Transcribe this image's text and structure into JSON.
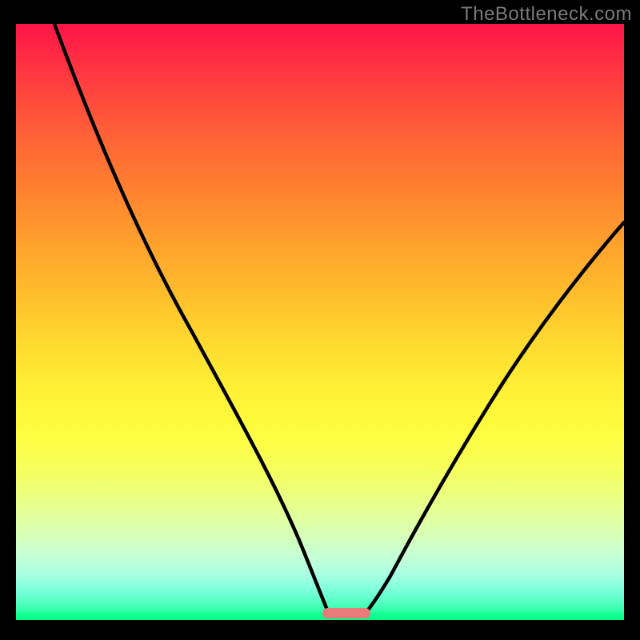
{
  "watermark": "TheBottleneck.com",
  "chart_data": {
    "type": "line",
    "title": "",
    "xlabel": "",
    "ylabel": "",
    "xlim": [
      0,
      100
    ],
    "ylim": [
      0,
      100
    ],
    "grid": false,
    "legend": false,
    "background_gradient": {
      "orientation": "vertical",
      "stops": [
        {
          "pos": 0,
          "color": "#ff1548"
        },
        {
          "pos": 50,
          "color": "#ffcc2e"
        },
        {
          "pos": 75,
          "color": "#f7ff58"
        },
        {
          "pos": 100,
          "color": "#00ff85"
        }
      ]
    },
    "series": [
      {
        "name": "left-curve",
        "x": [
          6,
          13,
          20,
          27,
          34,
          41,
          47,
          52
        ],
        "y": [
          100,
          78,
          58,
          42,
          28,
          16,
          7,
          1
        ]
      },
      {
        "name": "right-curve",
        "x": [
          57,
          62,
          68,
          75,
          82,
          90,
          100
        ],
        "y": [
          1,
          8,
          18,
          30,
          44,
          58,
          67
        ]
      }
    ],
    "optimal_marker": {
      "x_start": 50,
      "x_end": 58,
      "color": "#e87a78"
    }
  }
}
